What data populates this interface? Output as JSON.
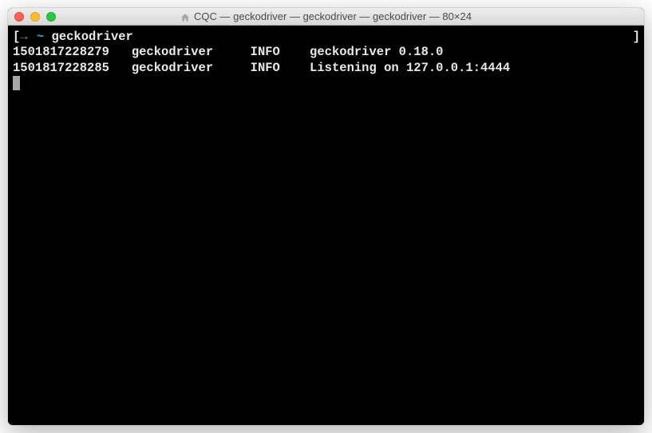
{
  "window": {
    "title": "CQC — geckodriver — geckodriver — geckodriver — 80×24"
  },
  "prompt": {
    "bracket_left": "[",
    "arrow": "→",
    "tilde": " ~ ",
    "command": "geckodriver",
    "bracket_right": "]"
  },
  "logs": [
    {
      "timestamp": "1501817228279",
      "component": "geckodriver",
      "level": "INFO",
      "message": "geckodriver 0.18.0"
    },
    {
      "timestamp": "1501817228285",
      "component": "geckodriver",
      "level": "INFO",
      "message": "Listening on 127.0.0.1:4444"
    }
  ]
}
